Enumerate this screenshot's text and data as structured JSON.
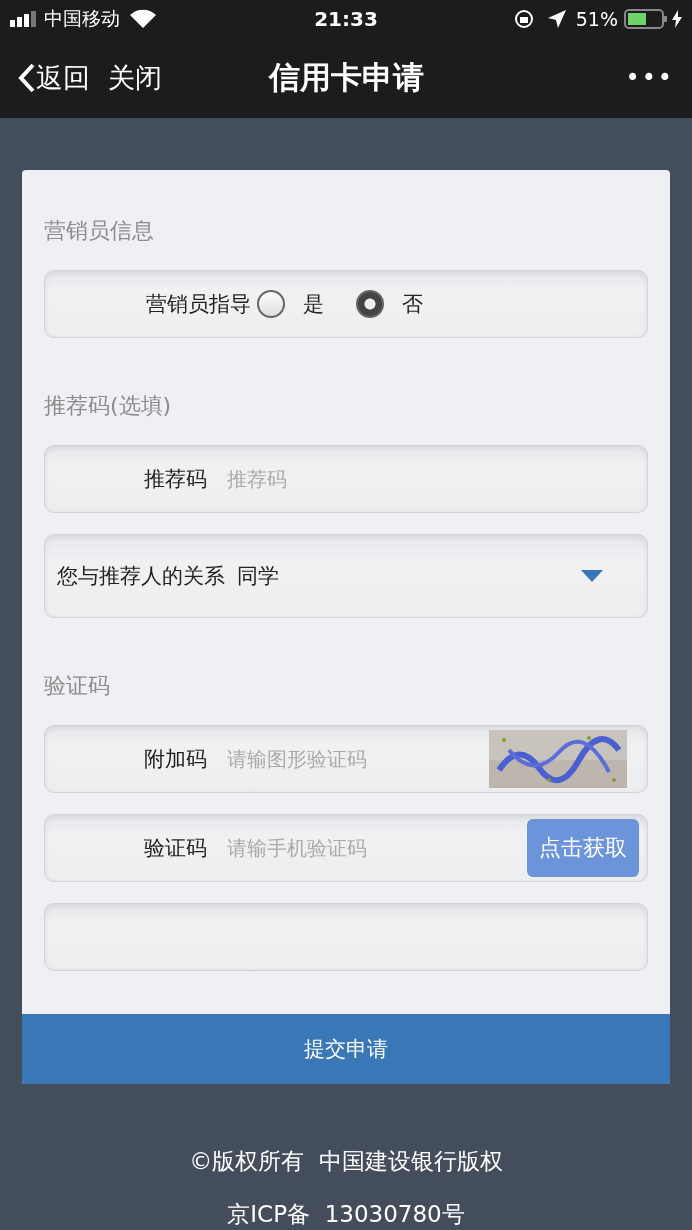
{
  "status_bar": {
    "carrier": "中国移动",
    "time": "21:33",
    "battery": "51%"
  },
  "nav": {
    "back": "返回",
    "close": "关闭",
    "title": "信用卡申请",
    "more": "•••"
  },
  "sections": [
    {
      "title": "营销员信息",
      "rows": [
        {
          "kind": "radio",
          "label": "营销员指导",
          "options": [
            {
              "label": "是",
              "selected": false
            },
            {
              "label": "否",
              "selected": true
            }
          ]
        }
      ]
    },
    {
      "title": "推荐码(选填)",
      "rows": [
        {
          "kind": "input",
          "label": "推荐码",
          "placeholder": "推荐码"
        },
        {
          "kind": "select",
          "label": "您与推荐人的关系",
          "value": "同学"
        }
      ]
    },
    {
      "title": "验证码",
      "rows": [
        {
          "kind": "captcha",
          "label": "附加码",
          "placeholder": "请输图形验证码"
        },
        {
          "kind": "sms",
          "label": "验证码",
          "placeholder": "请输手机验证码",
          "button": "点击获取"
        },
        {
          "kind": "blank"
        }
      ]
    }
  ],
  "submit": "提交申请",
  "footer": [
    "©版权所有  中国建设银行版权",
    "京ICP备  13030780号"
  ]
}
